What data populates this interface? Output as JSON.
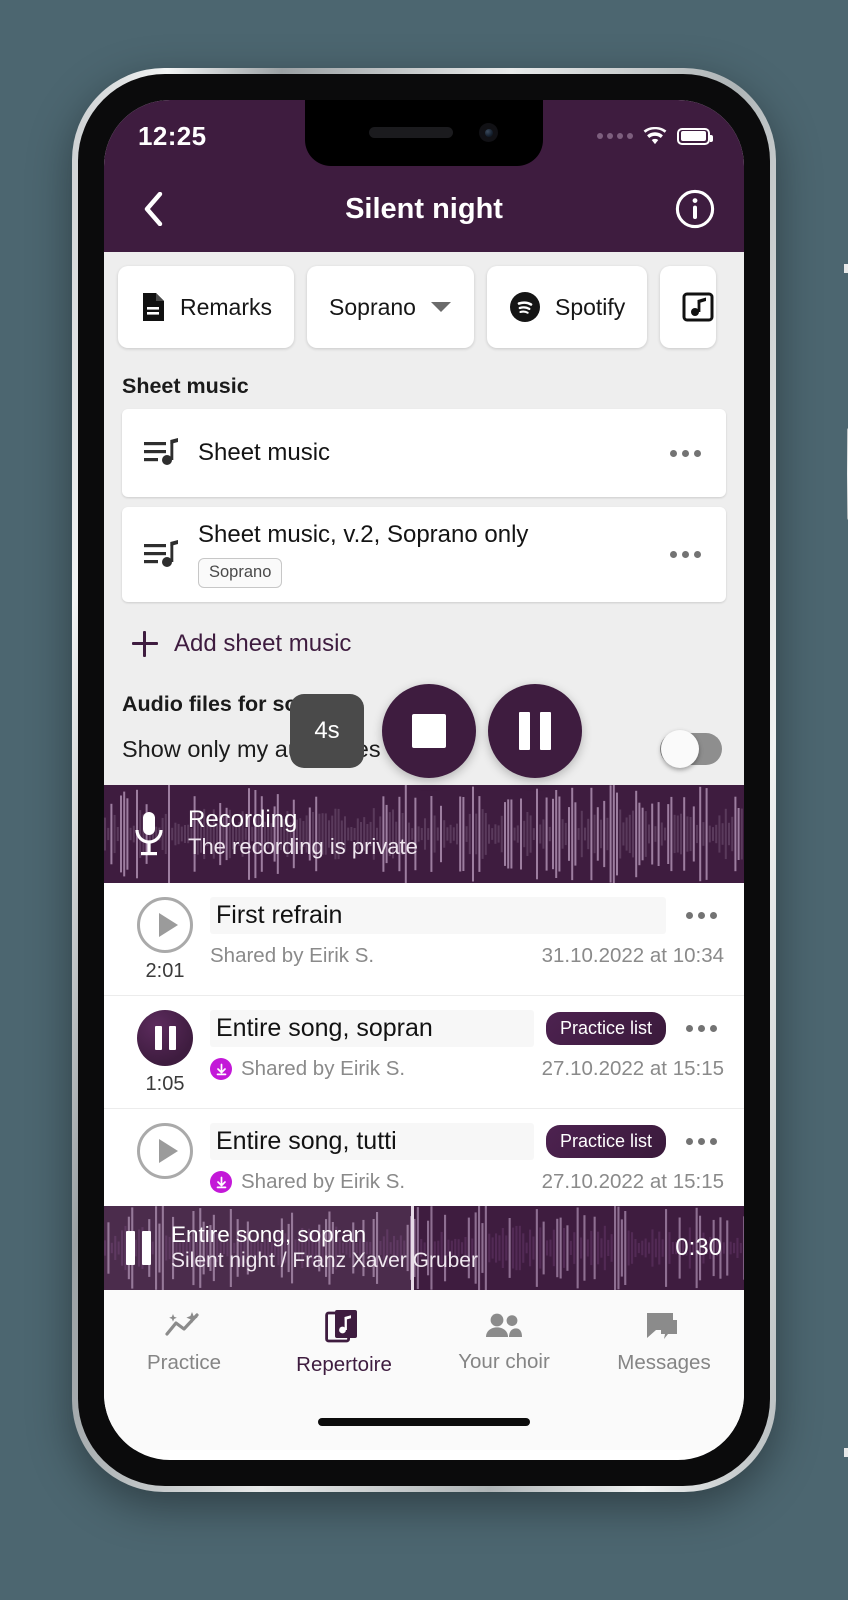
{
  "status_bar": {
    "time": "12:25",
    "signal_icon": "signal-dots-icon",
    "wifi_icon": "wifi-icon",
    "battery_icon": "battery-full-icon"
  },
  "app_bar": {
    "back_icon": "chevron-left-icon",
    "title": "Silent night",
    "info_icon": "info-circle-icon"
  },
  "chips": [
    {
      "label": "Remarks",
      "icon": "document-icon"
    },
    {
      "label": "Soprano",
      "icon": "chevron-down-icon",
      "trailing_caret": true
    },
    {
      "label": "Spotify",
      "icon": "spotify-icon"
    },
    {
      "label": "",
      "icon": "music-note-box-icon",
      "partial": true
    }
  ],
  "sheet_music": {
    "section_title": "Sheet music",
    "items": [
      {
        "name": "Sheet music",
        "icon": "sheet-music-icon",
        "tag": "",
        "menu_icon": "kebab-menu-icon"
      },
      {
        "name": "Sheet music, v.2, Soprano only",
        "icon": "sheet-music-icon",
        "tag": "Soprano",
        "menu_icon": "kebab-menu-icon"
      }
    ],
    "add_label": "Add sheet music",
    "add_icon": "plus-icon"
  },
  "audio_section": {
    "section_title": "Audio files for soprano",
    "toggle_label": "Show only my audio files",
    "toggle_on": false
  },
  "recording_banner": {
    "mic_icon": "microphone-icon",
    "title": "Recording",
    "subtitle": "The recording is private"
  },
  "audio_files": [
    {
      "state": "play",
      "play_icon": "play-circle-outline-icon",
      "duration": "2:01",
      "title": "First refrain",
      "pill": "",
      "shared_by": "Shared by Eirik S.",
      "downloaded": false,
      "date": "31.10.2022 at 10:34",
      "menu_icon": "kebab-menu-icon"
    },
    {
      "state": "pause",
      "play_icon": "pause-circle-filled-icon",
      "duration": "1:05",
      "title": "Entire song, sopran",
      "pill": "Practice list",
      "shared_by": "Shared by Eirik S.",
      "downloaded": true,
      "download_icon": "download-done-icon",
      "date": "27.10.2022 at 15:15",
      "menu_icon": "kebab-menu-icon"
    },
    {
      "state": "play",
      "play_icon": "play-circle-outline-icon",
      "duration": "",
      "title": "Entire song, tutti",
      "pill": "Practice list",
      "shared_by": "Shared by Eirik S.",
      "downloaded": true,
      "download_icon": "download-done-icon",
      "date": "27.10.2022 at 15:15",
      "menu_icon": "kebab-menu-icon"
    }
  ],
  "transport": {
    "elapsed_label": "4s",
    "stop_icon": "stop-icon",
    "pause_icon": "pause-icon"
  },
  "mini_player": {
    "pause_icon": "pause-icon",
    "track_title": "Entire song, sopran",
    "track_subtitle": "Silent night / Franz Xaver Gruber",
    "time": "0:30",
    "progress_percent": 48
  },
  "bottom_nav": [
    {
      "label": "Practice",
      "icon": "practice-chart-icon",
      "active": false
    },
    {
      "label": "Repertoire",
      "icon": "repertoire-book-icon",
      "active": true
    },
    {
      "label": "Your choir",
      "icon": "people-icon",
      "active": false
    },
    {
      "label": "Messages",
      "icon": "chat-bubbles-icon",
      "active": false
    }
  ],
  "colors": {
    "brand_purple": "#3E1C3F",
    "page_background": "#EEEEEE",
    "outside_background": "#4C6670",
    "accent_magenta": "#C318D8",
    "muted_text": "#8A8A8A"
  }
}
